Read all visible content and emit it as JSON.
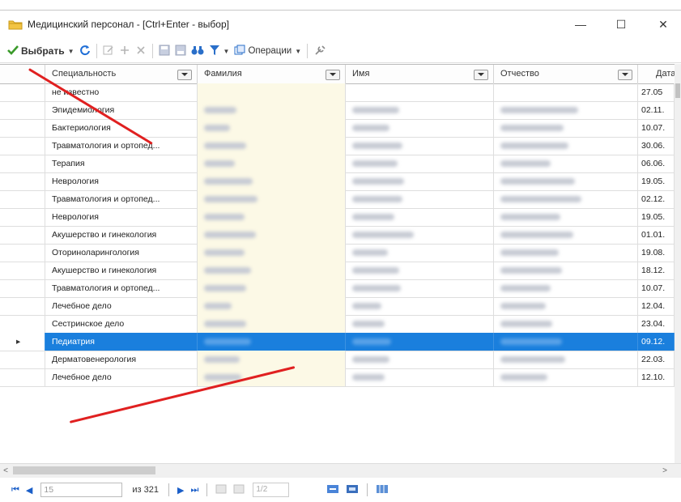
{
  "window": {
    "title": "Медицинский персонал - [Ctrl+Enter - выбор]",
    "minimize_symbol": "—",
    "maximize_symbol": "☐",
    "close_symbol": "✕"
  },
  "toolbar": {
    "select_label": "Выбрать",
    "operations_label": "Операции",
    "dropdown_symbol": "▼"
  },
  "grid": {
    "columns": [
      "Специальность",
      "Фамилия",
      "Имя",
      "Отчество",
      "Дата"
    ],
    "rows": [
      {
        "specialty": "не известно",
        "date": "27.05"
      },
      {
        "specialty": "Эпидемиология",
        "date": "02.11."
      },
      {
        "specialty": "Бактериология",
        "date": "10.07."
      },
      {
        "specialty": "Травматология и ортопед...",
        "date": "30.06."
      },
      {
        "specialty": "Терапия",
        "date": "06.06."
      },
      {
        "specialty": "Неврология",
        "date": "19.05."
      },
      {
        "specialty": "Травматология и ортопед...",
        "date": "02.12."
      },
      {
        "specialty": "Неврология",
        "date": "19.05."
      },
      {
        "specialty": "Акушерство и гинекология",
        "date": "01.01."
      },
      {
        "specialty": "Оториноларингология",
        "date": "19.08."
      },
      {
        "specialty": "Акушерство и гинекология",
        "date": "18.12."
      },
      {
        "specialty": "Травматология и ортопед...",
        "date": "10.07."
      },
      {
        "specialty": "Лечебное дело",
        "date": "12.04."
      },
      {
        "specialty": "Сестринское дело",
        "date": "23.04."
      },
      {
        "specialty": "Педиатрия",
        "date": "09.12."
      },
      {
        "specialty": "Дерматовенерология",
        "date": "22.03."
      },
      {
        "specialty": "Лечебное дело",
        "date": "12.10."
      }
    ],
    "selected_row_index": 14,
    "current_row_marker": "▸"
  },
  "navigator": {
    "first_symbol": "⏮",
    "prev_symbol": "◀",
    "record_value": "15",
    "of_text": "из 321",
    "next_symbol": "▶",
    "last_symbol": "⏭",
    "page_value": "1/2"
  },
  "scroll": {
    "left_symbol": "<",
    "right_symbol": ">"
  },
  "colors": {
    "selection": "#1a7fdd",
    "annotation_arrow": "#e02020",
    "surname_column_bg": "#fcf9e6"
  }
}
